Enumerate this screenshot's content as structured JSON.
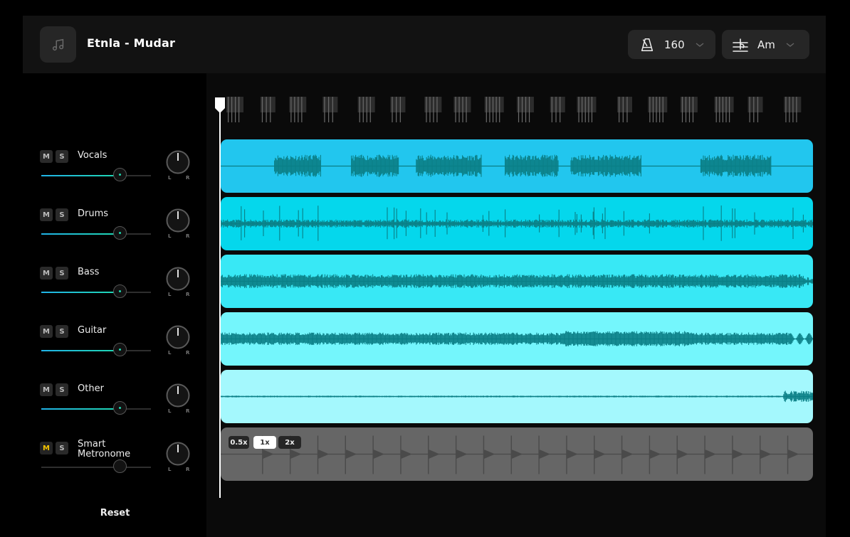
{
  "header": {
    "song_icon": "music-note-icon",
    "title": "Etnla - Mudar",
    "tempo": {
      "icon": "metronome-icon",
      "value": "160",
      "dropdown_icon": "chevron-down-icon"
    },
    "key": {
      "icon": "key-signature-icon",
      "value": "Am",
      "dropdown_icon": "chevron-down-icon"
    }
  },
  "tracks": [
    {
      "name": "Vocals",
      "mute": "M",
      "solo": "S",
      "muted": false,
      "volume": 0.72,
      "pan": 0.0,
      "pan_left": "L",
      "pan_right": "R",
      "color": "#22c6ee"
    },
    {
      "name": "Drums",
      "mute": "M",
      "solo": "S",
      "muted": false,
      "volume": 0.72,
      "pan": 0.0,
      "pan_left": "L",
      "pan_right": "R",
      "color": "#05d7ec"
    },
    {
      "name": "Bass",
      "mute": "M",
      "solo": "S",
      "muted": false,
      "volume": 0.72,
      "pan": 0.0,
      "pan_left": "L",
      "pan_right": "R",
      "color": "#38e8f5"
    },
    {
      "name": "Guitar",
      "mute": "M",
      "solo": "S",
      "muted": false,
      "volume": 0.72,
      "pan": 0.0,
      "pan_left": "L",
      "pan_right": "R",
      "color": "#74f6fc"
    },
    {
      "name": "Other",
      "mute": "M",
      "solo": "S",
      "muted": false,
      "volume": 0.72,
      "pan": 0.0,
      "pan_left": "L",
      "pan_right": "R",
      "color": "#a4f8fd"
    },
    {
      "name_line1": "Smart",
      "name_line2": "Metronome",
      "name": "Smart Metronome",
      "mute": "M",
      "solo": "S",
      "muted": true,
      "volume": 0.72,
      "pan": 0.0,
      "pan_left": "L",
      "pan_right": "R",
      "color": "#666666"
    }
  ],
  "metronome_speeds": [
    {
      "label": "0.5x",
      "selected": false
    },
    {
      "label": "1x",
      "selected": true
    },
    {
      "label": "2x",
      "selected": false
    }
  ],
  "waveform_color": "#0b7f86",
  "playhead_position": 0.0,
  "reset_label": "Reset"
}
